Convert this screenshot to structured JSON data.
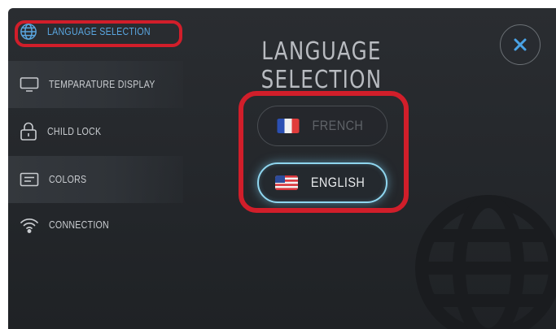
{
  "sidebar": {
    "items": [
      {
        "label": "LANGUAGE SELECTION",
        "icon": "globe-icon",
        "active": true
      },
      {
        "label": "TEMPARATURE DISPLAY",
        "icon": "monitor-icon"
      },
      {
        "label": "CHILD LOCK",
        "icon": "lock-icon"
      },
      {
        "label": "COLORS",
        "icon": "card-icon"
      },
      {
        "label": "CONNECTION",
        "icon": "wifi-icon"
      }
    ]
  },
  "main": {
    "title": "LANGUAGE SELECTION",
    "close_icon": "close-icon",
    "languages": [
      {
        "label": "FRENCH",
        "flag": "france-flag-icon",
        "selected": false
      },
      {
        "label": "ENGLISH",
        "flag": "us-flag-icon",
        "selected": true
      }
    ]
  },
  "colors": {
    "accent": "#5aa6e0",
    "highlight": "#d11e2a",
    "selected_glow": "#8fd6ef",
    "background": "#26292d"
  }
}
